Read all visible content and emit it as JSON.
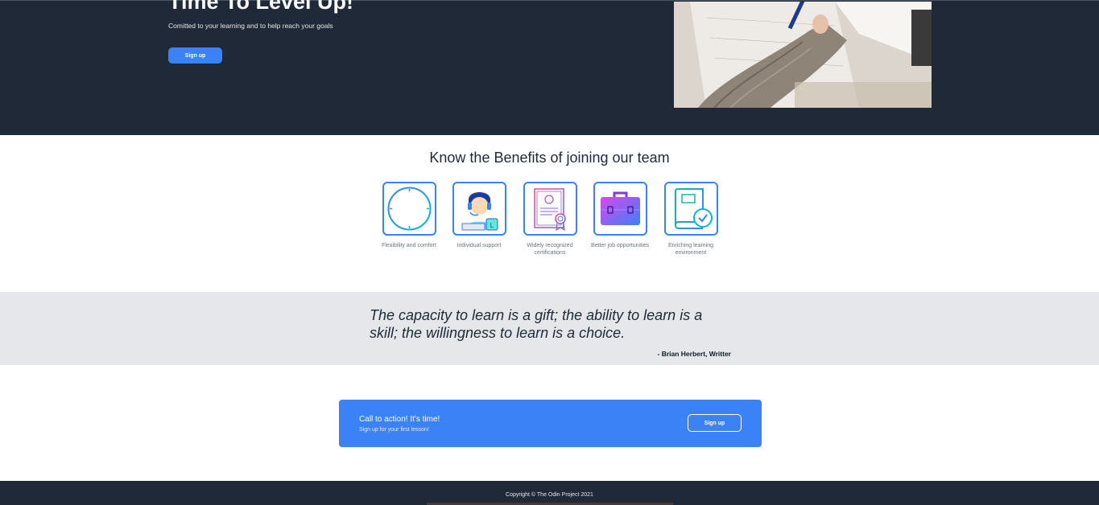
{
  "hero": {
    "title": "Time To Level Up!",
    "subtitle": "Comitted to your learning and to help reach your goals",
    "button_label": "Sign up",
    "image_icon": "person-writing-photo"
  },
  "benefits": {
    "title": "Know the Benefits of joining our team",
    "items": [
      {
        "label": "Flexibility and comfort",
        "icon": "clock-icon"
      },
      {
        "label": "Individual support",
        "icon": "support-agent-icon"
      },
      {
        "label": "Widely recognized certifications",
        "icon": "certificate-icon"
      },
      {
        "label": "Better job opportunities",
        "icon": "briefcase-icon"
      },
      {
        "label": "Enriching learning environment",
        "icon": "book-check-icon"
      }
    ]
  },
  "quote": {
    "text": "The capacity to learn is a gift; the ability to learn is a skill; the willingness to learn is a choice.",
    "author": "- Brian Herbert, Writter"
  },
  "cta": {
    "title": "Call to action! It's time!",
    "subtitle": "Sign up for your first lesson!",
    "button_label": "Sign up"
  },
  "footer": {
    "text": "Copyright © The Odin Project 2021"
  },
  "colors": {
    "primary": "#3b82f6",
    "dark": "#1f2937",
    "light_band": "#e5e7eb"
  }
}
